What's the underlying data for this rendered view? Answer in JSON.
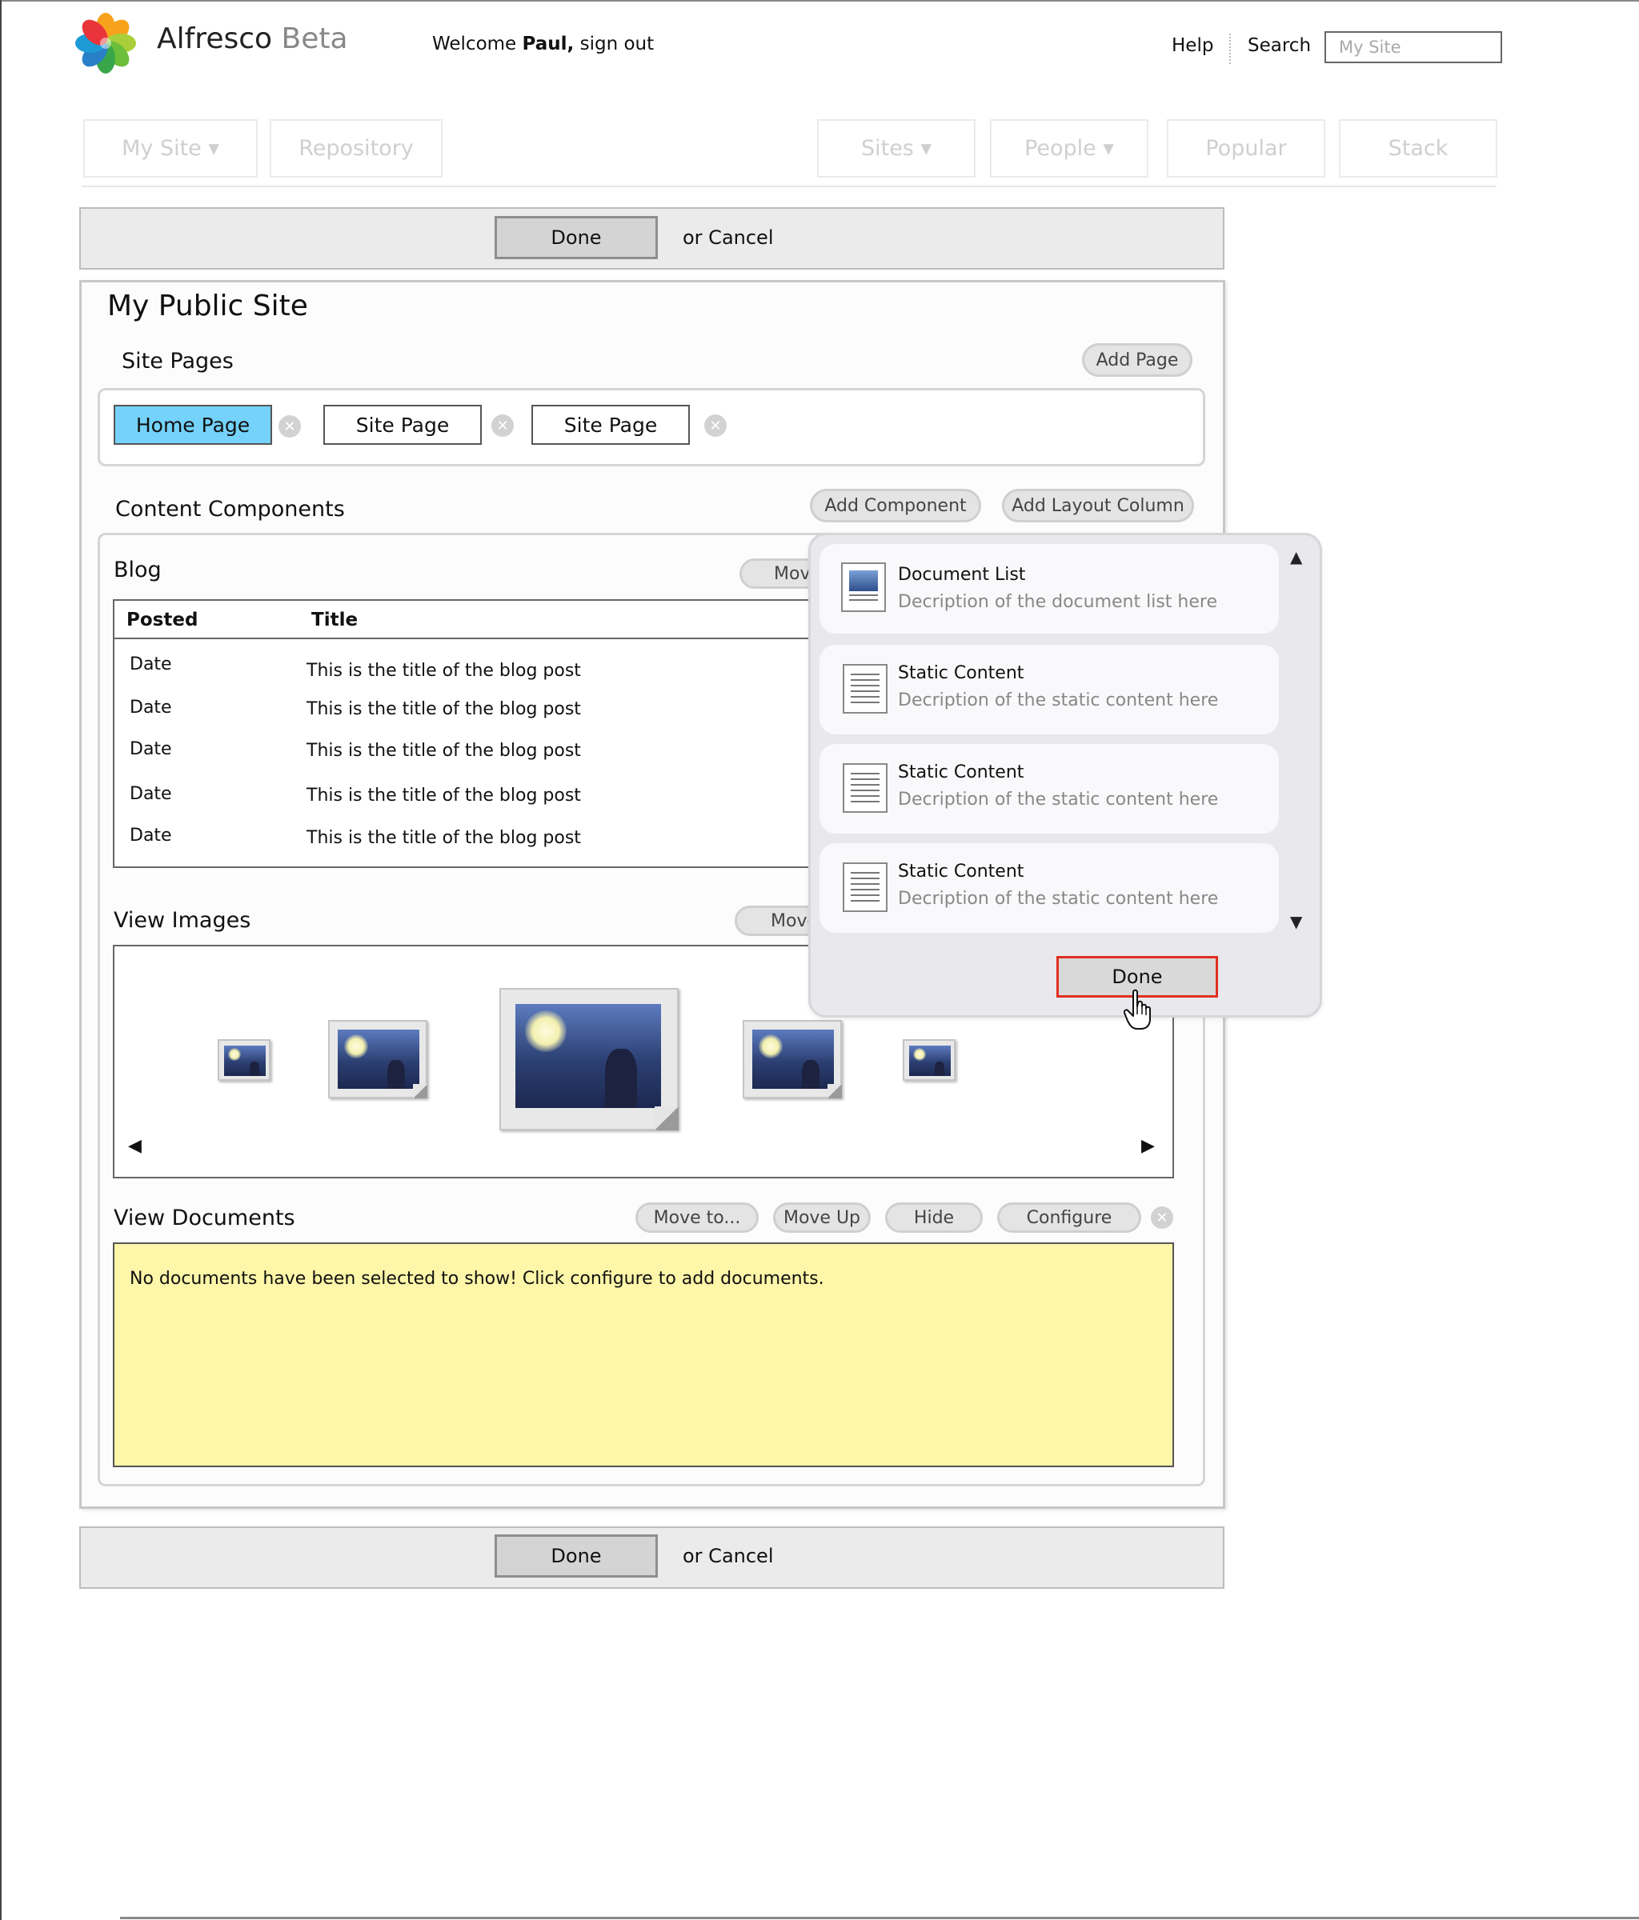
{
  "header": {
    "brand_name": "Alfresco",
    "brand_suffix": "Beta",
    "welcome_prefix": "Welcome",
    "user_name": "Paul,",
    "sign_out": "sign out",
    "help": "Help",
    "search": "Search",
    "search_placeholder": "My Site"
  },
  "nav": {
    "my_site": "My Site ▾",
    "repository": "Repository",
    "sites": "Sites ▾",
    "people": "People ▾",
    "popular": "Popular",
    "stack": "Stack"
  },
  "top_bar": {
    "done": "Done",
    "or_cancel": "or Cancel"
  },
  "bottom_bar": {
    "done": "Done",
    "or_cancel": "or Cancel"
  },
  "site": {
    "title": "My Public Site",
    "site_pages_label": "Site Pages",
    "add_page": "Add Page",
    "pages": [
      "Home Page",
      "Site Page",
      "Site Page"
    ],
    "content_components_label": "Content Components",
    "add_component": "Add Component",
    "add_layout_column": "Add Layout Column"
  },
  "blog": {
    "title": "Blog",
    "move": "Move",
    "columns": [
      "Posted",
      "Title"
    ],
    "rows": [
      {
        "posted": "Date",
        "title": "This is the title of the blog post"
      },
      {
        "posted": "Date",
        "title": "This is the title of the blog post"
      },
      {
        "posted": "Date",
        "title": "This is the title of the blog post"
      },
      {
        "posted": "Date",
        "title": "This is the title of the blog post"
      },
      {
        "posted": "Date",
        "title": "This is the title of the blog post"
      }
    ]
  },
  "view_images": {
    "title": "View Images",
    "move": "Move",
    "prev_icon": "◀",
    "next_icon": "▶"
  },
  "view_documents": {
    "title": "View Documents",
    "move_to": "Move to...",
    "move_up": "Move Up",
    "hide": "Hide",
    "configure": "Configure",
    "empty_message": "No documents have been selected to show! Click configure to add documents."
  },
  "component_picker": {
    "items": [
      {
        "title": "Document List",
        "description": "Decription of the document list here",
        "icon": "document-list-icon"
      },
      {
        "title": "Static Content",
        "description": "Decription of the static content here",
        "icon": "static-content-icon"
      },
      {
        "title": "Static Content",
        "description": "Decription of the static content here",
        "icon": "static-content-icon"
      },
      {
        "title": "Static Content",
        "description": "Decription of the static content here",
        "icon": "static-content-icon"
      }
    ],
    "scroll_up_icon": "▲",
    "scroll_down_icon": "▼",
    "done": "Done"
  },
  "colors": {
    "active_page": "#74d2fb",
    "note_background": "#fef6a8",
    "highlight_border": "#e03020"
  }
}
